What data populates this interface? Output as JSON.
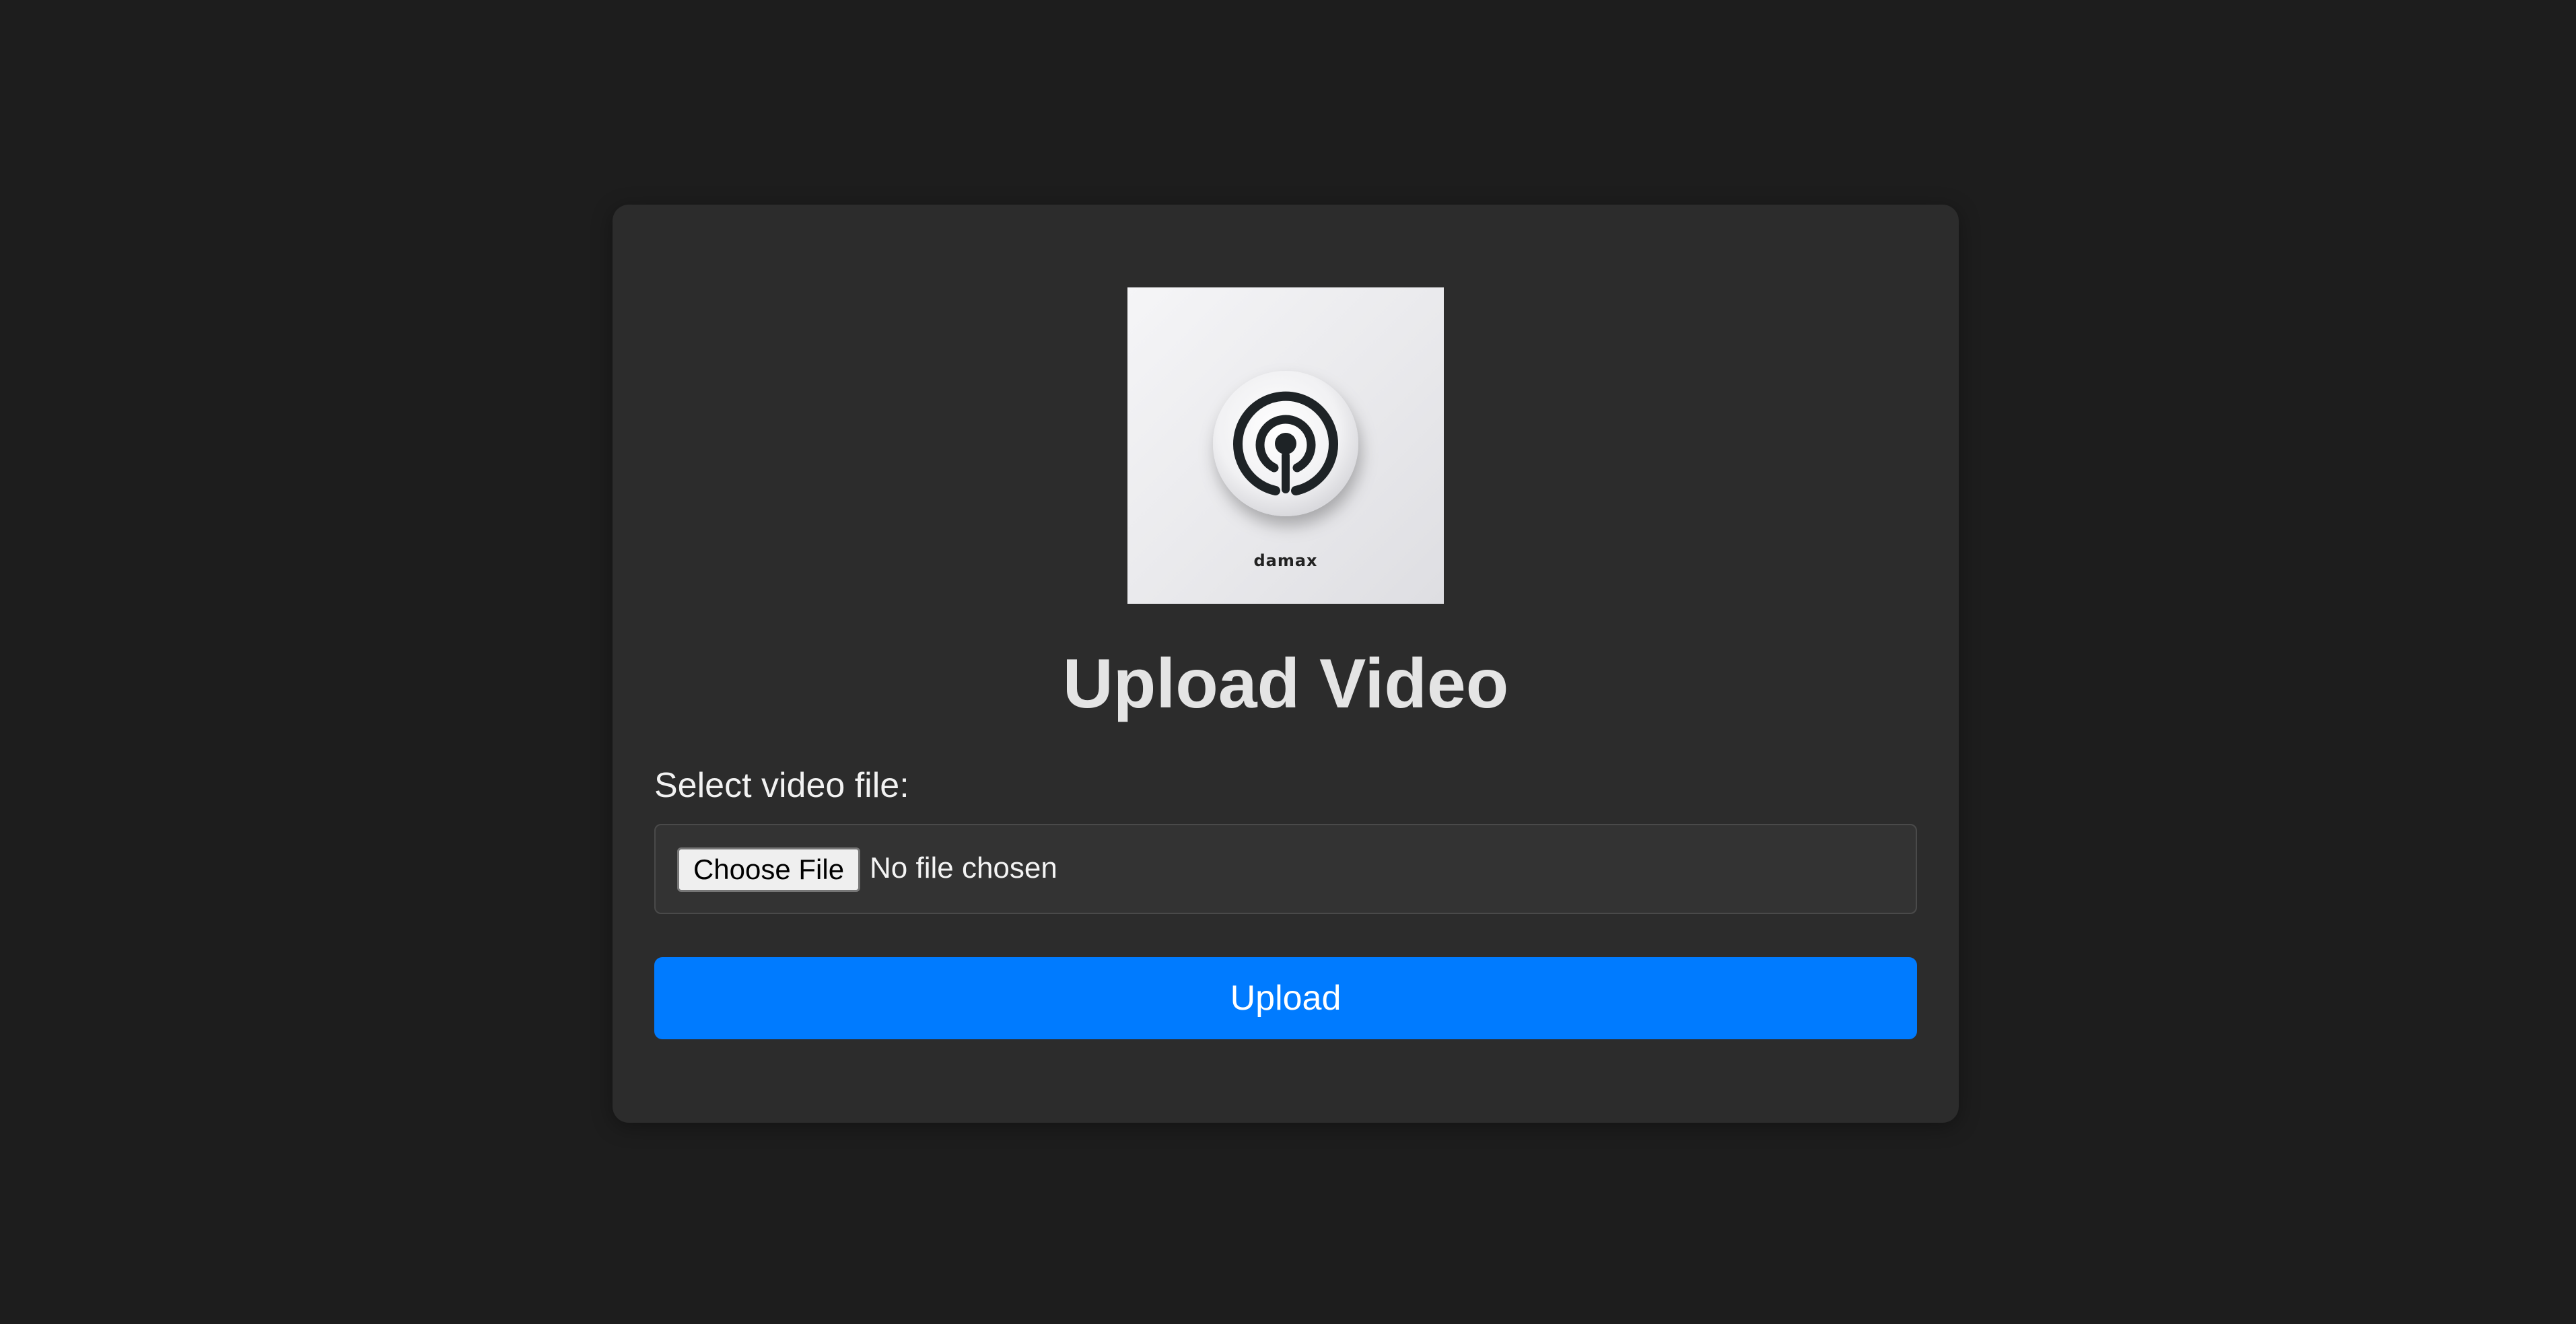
{
  "logo": {
    "alt": "damax",
    "brand_text": "damax"
  },
  "page": {
    "title": "Upload Video"
  },
  "form": {
    "file_label": "Select video file:",
    "choose_file_label": "Choose File",
    "no_file_text": "No file chosen",
    "upload_label": "Upload"
  },
  "colors": {
    "background": "#1d1d1d",
    "card": "#2c2c2c",
    "accent": "#007bff"
  }
}
